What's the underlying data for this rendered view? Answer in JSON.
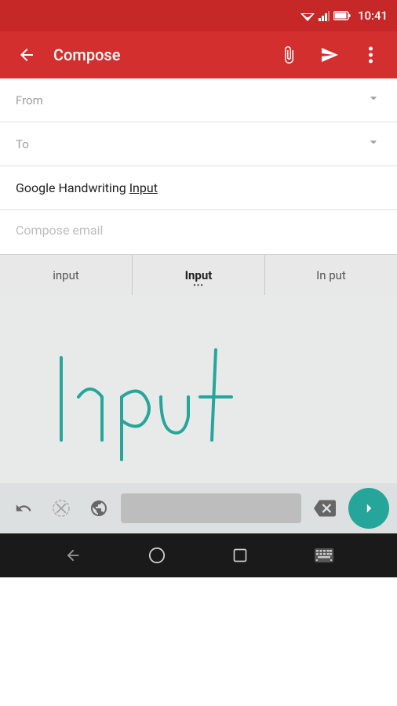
{
  "statusBar": {
    "time": "10:41",
    "wifiIcon": "▲",
    "signalIcon": "▲",
    "batteryIcon": "▪"
  },
  "appBar": {
    "title": "Compose",
    "backLabel": "←",
    "attachLabel": "📎",
    "sendLabel": "▶",
    "moreLabel": "⋮"
  },
  "form": {
    "fromLabel": "From",
    "toLabel": "To",
    "subject": "Google Handwriting Input",
    "subjectUnderline": "Input",
    "composePlaceholder": "Compose email"
  },
  "suggestions": [
    {
      "text": "input",
      "selected": false
    },
    {
      "text": "Input",
      "selected": true
    },
    {
      "text": "In put",
      "selected": false
    }
  ],
  "keyboard": {
    "undoLabel": "↺",
    "deleteWordLabel": "⌫",
    "globeLabel": "⊕",
    "backspaceLabel": "⌫",
    "enterLabel": "›"
  },
  "navBar": {
    "backLabel": "▽",
    "homeLabel": "○",
    "recentLabel": "□",
    "keyboardLabel": "⌨"
  }
}
